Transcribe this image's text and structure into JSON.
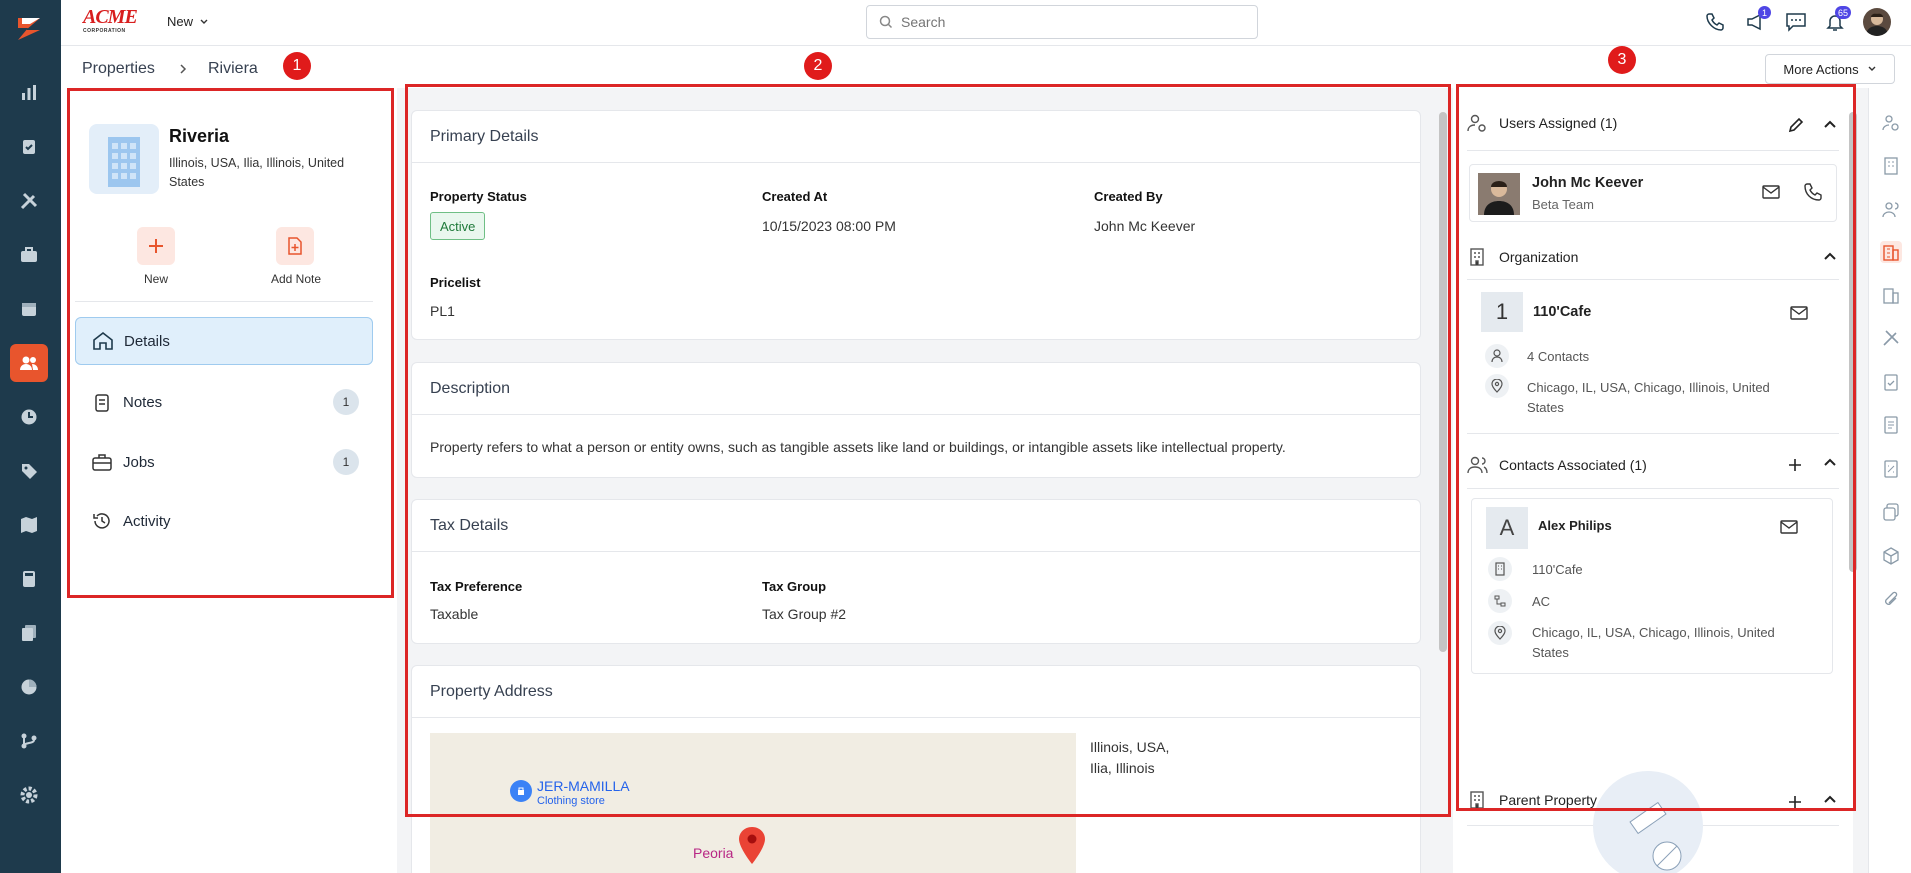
{
  "app": {
    "brand_top": "ACME",
    "brand_bottom": "CORPORATION",
    "new_label": "New"
  },
  "search": {
    "placeholder": "Search"
  },
  "badges": {
    "notifications_a": "1",
    "bell": "65"
  },
  "breadcrumb": {
    "root": "Properties",
    "current": "Riviera"
  },
  "markers": [
    "1",
    "2",
    "3"
  ],
  "more_actions": "More Actions",
  "property": {
    "name": "Riveria",
    "address": "Illinois, USA, Ilia, Illinois, United States",
    "actions": [
      {
        "label": "New"
      },
      {
        "label": "Add Note"
      }
    ]
  },
  "menu": [
    {
      "label": "Details",
      "count": ""
    },
    {
      "label": "Notes",
      "count": "1"
    },
    {
      "label": "Jobs",
      "count": "1"
    },
    {
      "label": "Activity",
      "count": ""
    }
  ],
  "primary": {
    "title": "Primary Details",
    "status_label": "Property Status",
    "status_value": "Active",
    "created_at_label": "Created At",
    "created_at_value": "10/15/2023 08:00 PM",
    "created_by_label": "Created By",
    "created_by_value": "John Mc Keever",
    "pricelist_label": "Pricelist",
    "pricelist_value": "PL1"
  },
  "description": {
    "title": "Description",
    "text": "Property refers to what a person or entity owns, such as tangible assets like land or buildings, or intangible assets like intellectual property."
  },
  "tax": {
    "title": "Tax Details",
    "pref_label": "Tax Preference",
    "pref_value": "Taxable",
    "group_label": "Tax Group",
    "group_value": "Tax Group #2"
  },
  "address": {
    "title": "Property Address",
    "line1": "Illinois, USA,",
    "line2": "Ilia, Illinois",
    "map_place": "JER-MAMILLA",
    "map_place_sub": "Clothing store",
    "map_city": "Peoria"
  },
  "users": {
    "title": "Users Assigned (1)",
    "name": "John Mc Keever",
    "team": "Beta Team"
  },
  "organization": {
    "title": "Organization",
    "initial": "1",
    "name": "110'Cafe",
    "contacts": "4 Contacts",
    "address": "Chicago, IL, USA, Chicago, Illinois, United States"
  },
  "contacts": {
    "title": "Contacts Associated (1)",
    "initial": "A",
    "name": "Alex Philips",
    "org": "110'Cafe",
    "code": "AC",
    "address": "Chicago, IL, USA, Chicago, Illinois, United States"
  },
  "parent": {
    "title": "Parent Property"
  },
  "colors": {
    "accent": "#e8552d",
    "nav": "#1e3a4c",
    "marker": "#dc2626",
    "active": "#1f7a3a"
  }
}
